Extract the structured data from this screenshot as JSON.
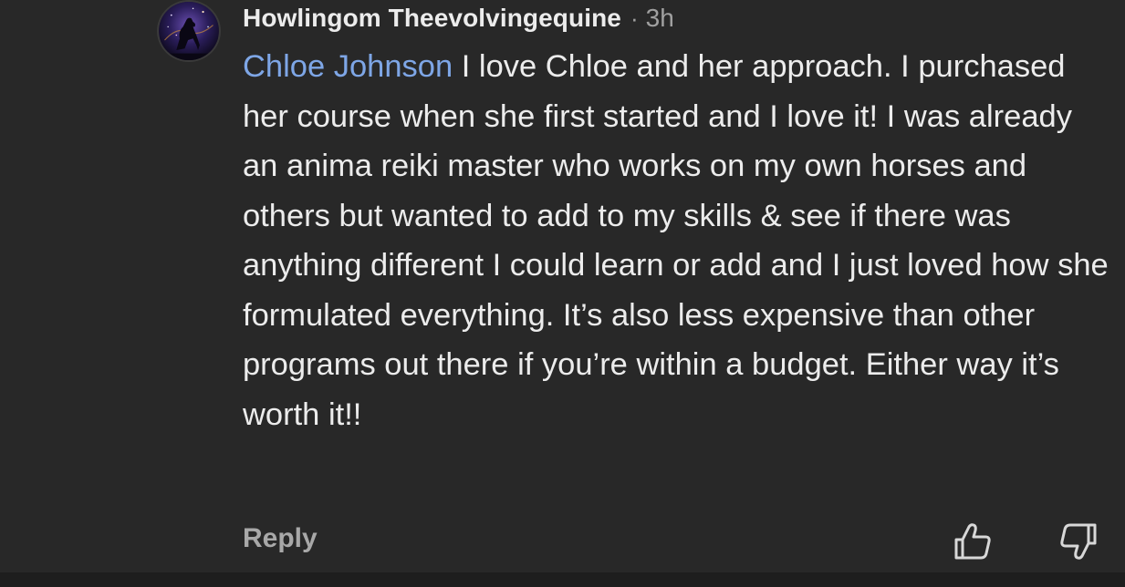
{
  "comment": {
    "author": "Howlingom Theevolvingequine",
    "separator": "·",
    "time": "3h",
    "mention": "Chloe Johnson",
    "text": "I love Chloe and her approach. I purchased her course when she first started and I love it! I was already an anima reiki master who works on my own horses and others but wanted to add to my skills & see if there was anything different I could learn or add and I just loved how she formulated everything. It’s also less expensive than other programs out there if you’re within a budget. Either way it’s worth it!!"
  },
  "actions": {
    "reply_label": "Reply",
    "like_icon": "thumbs-up-icon",
    "dislike_icon": "thumbs-down-icon"
  },
  "colors": {
    "background": "#282828",
    "text": "#ececec",
    "mention": "#7ea6e6",
    "muted": "#a0a0a0"
  }
}
